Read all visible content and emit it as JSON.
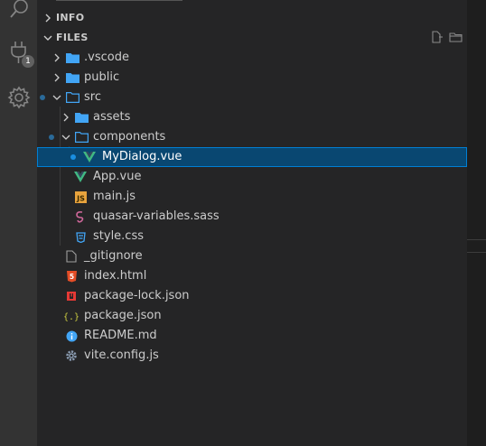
{
  "sections": {
    "info": {
      "title": "INFO"
    },
    "files": {
      "title": "FILES"
    }
  },
  "badge": {
    "extensions_count": "1"
  },
  "tree": [
    {
      "label": ".vscode",
      "type": "folder",
      "expanded": false
    },
    {
      "label": "public",
      "type": "folder",
      "expanded": false
    },
    {
      "label": "src",
      "type": "folder",
      "expanded": true,
      "modified": true
    },
    {
      "label": "assets",
      "type": "folder",
      "expanded": false
    },
    {
      "label": "components",
      "type": "folder",
      "expanded": true,
      "modified": true
    },
    {
      "label": "MyDialog.vue",
      "type": "vue",
      "selected": true,
      "modified": true
    },
    {
      "label": "App.vue",
      "type": "vue"
    },
    {
      "label": "main.js",
      "type": "js"
    },
    {
      "label": "quasar-variables.sass",
      "type": "sass"
    },
    {
      "label": "style.css",
      "type": "css"
    },
    {
      "label": "_gitignore",
      "type": "file"
    },
    {
      "label": "index.html",
      "type": "html"
    },
    {
      "label": "package-lock.json",
      "type": "lock"
    },
    {
      "label": "package.json",
      "type": "json"
    },
    {
      "label": "README.md",
      "type": "info"
    },
    {
      "label": "vite.config.js",
      "type": "config"
    }
  ],
  "colors": {
    "folder": "#42a5f5",
    "vue": "#41b883",
    "js": "#e8a33d",
    "sass": "#cd6799",
    "css": "#42a5f5",
    "html": "#e44d26",
    "lock": "#e53935",
    "json": "#cbcb41",
    "info": "#42a5f5",
    "selected_bg": "#094771"
  }
}
